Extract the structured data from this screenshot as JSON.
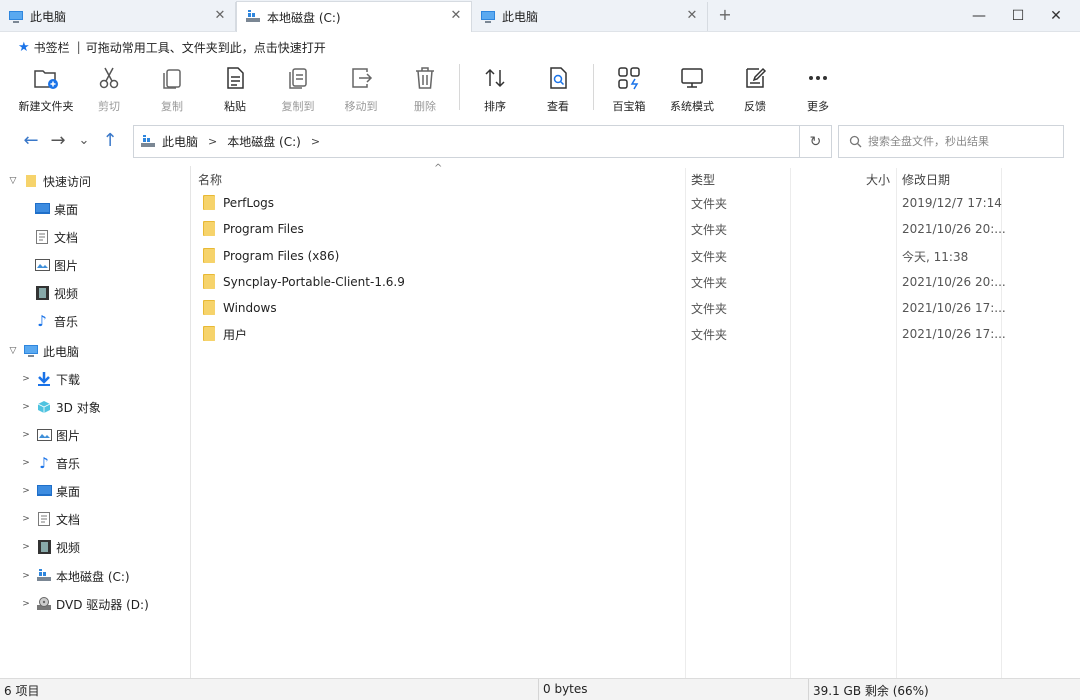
{
  "tabs": [
    {
      "label": "此电脑",
      "close": "✕"
    },
    {
      "label": "本地磁盘 (C:)",
      "close": "✕"
    },
    {
      "label": "此电脑",
      "close": "✕"
    }
  ],
  "new_tab": "+",
  "window_controls": {
    "minimize": "—",
    "maximize": "☐",
    "close": "✕"
  },
  "bookmarks": {
    "title": "书签栏",
    "hint": "可拖动常用工具、文件夹到此，点击快速打开"
  },
  "toolbar": {
    "new_folder": "新建文件夹",
    "cut": "剪切",
    "copy": "复制",
    "paste": "粘贴",
    "copy_to": "复制到",
    "move_to": "移动到",
    "delete": "删除",
    "sort": "排序",
    "view": "查看",
    "toolbox": "百宝箱",
    "system_mode": "系统模式",
    "feedback": "反馈",
    "more": "更多"
  },
  "address": {
    "crumbs": [
      "此电脑",
      "本地磁盘 (C:)"
    ]
  },
  "search": {
    "placeholder": "搜索全盘文件，秒出结果"
  },
  "sidebar": {
    "quick_access": "快速访问",
    "quick_items": [
      "桌面",
      "文档",
      "图片",
      "视频",
      "音乐"
    ],
    "this_pc": "此电脑",
    "pc_items": [
      "下载",
      "3D 对象",
      "图片",
      "音乐",
      "桌面",
      "文档",
      "视频",
      "本地磁盘 (C:)",
      "DVD 驱动器 (D:)"
    ]
  },
  "columns": {
    "name": "名称",
    "type": "类型",
    "size": "大小",
    "date": "修改日期"
  },
  "files": [
    {
      "name": "PerfLogs",
      "type": "文件夹",
      "date": "2019/12/7 17:14"
    },
    {
      "name": "Program Files",
      "type": "文件夹",
      "date": "2021/10/26 20:..."
    },
    {
      "name": "Program Files (x86)",
      "type": "文件夹",
      "date": "今天, 11:38"
    },
    {
      "name": "Syncplay-Portable-Client-1.6.9",
      "type": "文件夹",
      "date": "2021/10/26 20:..."
    },
    {
      "name": "Windows",
      "type": "文件夹",
      "date": "2021/10/26 17:..."
    },
    {
      "name": "用户",
      "type": "文件夹",
      "date": "2021/10/26 17:..."
    }
  ],
  "status": {
    "count": "6 项目",
    "size": "0 bytes",
    "free": "39.1 GB 剩余 (66%)"
  },
  "colors": {
    "accent": "#1a73e8",
    "folder": "#f6d36b",
    "folder_dark": "#e8b935"
  }
}
